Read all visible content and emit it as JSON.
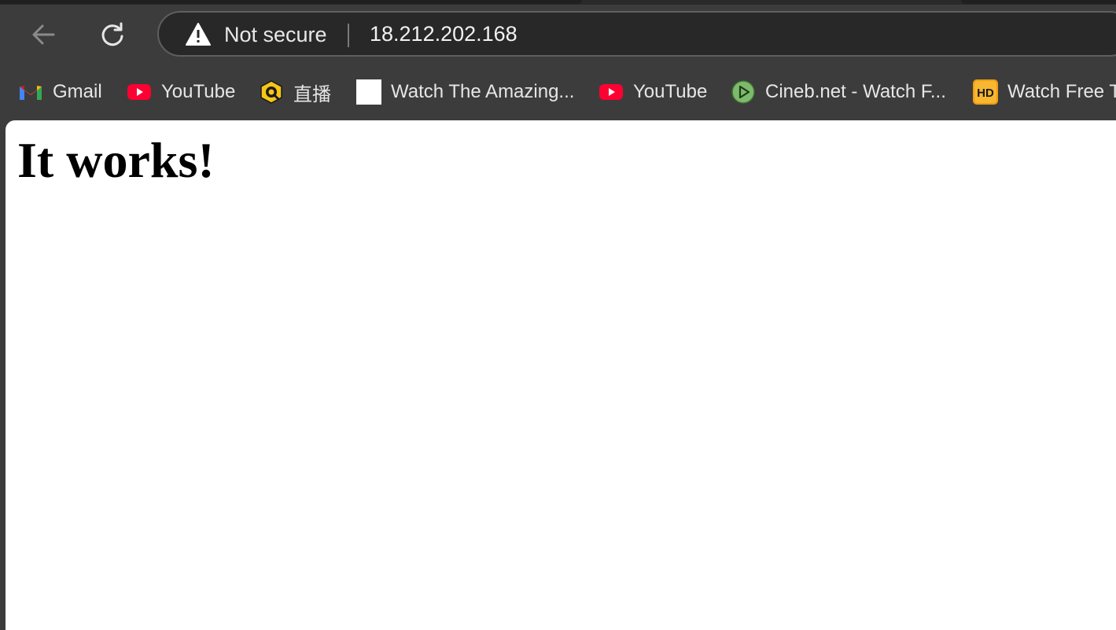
{
  "toolbar": {
    "security_label": "Not secure",
    "url": "18.212.202.168"
  },
  "bookmarks": [
    {
      "label": "Gmail",
      "icon": "gmail-icon"
    },
    {
      "label": "YouTube",
      "icon": "youtube-icon"
    },
    {
      "label": "直播",
      "icon": "live-stream-icon"
    },
    {
      "label": "Watch The Amazing...",
      "icon": "blank-page-icon"
    },
    {
      "label": "YouTube",
      "icon": "youtube-icon"
    },
    {
      "label": "Cineb.net - Watch F...",
      "icon": "play-circle-icon"
    },
    {
      "label": "Watch Free T",
      "icon": "hd-icon"
    }
  ],
  "page": {
    "heading": "It works!"
  },
  "colors": {
    "chrome_bg": "#3c3c3c",
    "omnibox_bg": "#282828",
    "youtube_red": "#ff0033",
    "page_bg": "#ffffff"
  }
}
